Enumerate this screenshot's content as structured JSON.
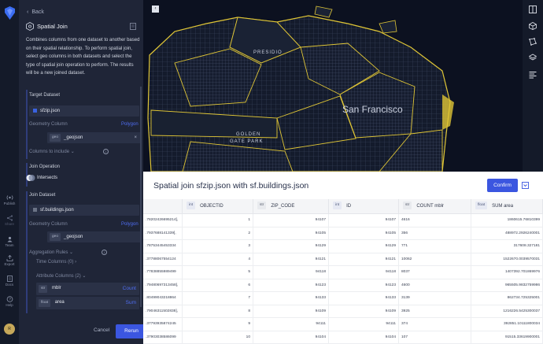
{
  "rail": {
    "items": [
      {
        "label": "Publish",
        "icon": "broadcast-icon"
      },
      {
        "label": "Share",
        "icon": "share-icon"
      },
      {
        "label": "Team",
        "icon": "team-icon"
      },
      {
        "label": "Export",
        "icon": "export-icon"
      },
      {
        "label": "Docs",
        "icon": "docs-icon"
      },
      {
        "label": "Help",
        "icon": "help-icon"
      }
    ],
    "avatar_initials": "R"
  },
  "panel": {
    "back_label": "Back",
    "title": "Spatial Join",
    "description": "Combines columns from one dataset to another based on their spatial relationship. To perform spatial join, select geo columns in both datasets and select the type of spatial join operation to perform. The results will be a new joined dataset.",
    "target": {
      "section_label": "Target Dataset",
      "dataset": "sfzip.json",
      "geometry_label": "Geometry Column",
      "geometry_type": "Polygon",
      "geometry_chip": "geo",
      "geometry_value": "_geojson",
      "columns_label": "Columns to include"
    },
    "join_operation": {
      "section_label": "Join Operation",
      "value": "Intersects"
    },
    "join": {
      "section_label": "Join Dataset",
      "dataset": "sf.buildings.json",
      "geometry_label": "Geometry Column",
      "geometry_type": "Polygon",
      "geometry_chip": "geo",
      "geometry_value": "_geojson",
      "aggregation_label": "Aggregation Rules",
      "time_columns_label": "Time Columns (0)",
      "attribute_columns_label": "Attribute Columns (2)",
      "rules": [
        {
          "chip": "str",
          "name": "mblr",
          "agg": "Count"
        },
        {
          "chip": "float",
          "name": "area",
          "agg": "Sum"
        }
      ]
    },
    "cancel_label": "Cancel",
    "rerun_label": "Rerun"
  },
  "map": {
    "city_label": "San Francisco",
    "presidio_label": "PRESIDIO",
    "park_label_1": "GOLDEN",
    "park_label_2": "GATE PARK",
    "collapse_glyph": "‹"
  },
  "table": {
    "title": "Spatial join sfzip.json with sf.buildings.json",
    "confirm_label": "Confirm",
    "columns": [
      {
        "type": "",
        "name": ""
      },
      {
        "type": "int",
        "name": "OBJECTID"
      },
      {
        "type": "str",
        "name": "ZIP_CODE"
      },
      {
        "type": "int",
        "name": "ID"
      },
      {
        "type": "str",
        "name": "COUNT mblr"
      },
      {
        "type": "float",
        "name": "SUM area"
      }
    ],
    "rows": [
      [
        ".78202426695214],",
        "1",
        "94107",
        "94107",
        "4616",
        "1860615.76810399"
      ],
      [
        ".7937688141339],",
        "2",
        "94105",
        "94105",
        "356",
        "488972.2926240001"
      ],
      [
        ".78753445453334",
        "3",
        "94129",
        "94129",
        "771",
        "317608.327181"
      ],
      [
        ".37788067554124",
        "4",
        "94121",
        "94121",
        "10062",
        "1522670.0039570031"
      ],
      [
        ".77838855989499",
        "5",
        "94118",
        "94118",
        "8037",
        "1407392.701869976"
      ],
      [
        ".79480697313458],",
        "6",
        "94123",
        "94123",
        "4600",
        "965505.9832759986"
      ],
      [
        ".80499043218864",
        "7",
        "94133",
        "94133",
        "3139",
        "862734.725325001"
      ],
      [
        ".79046311502838],",
        "8",
        "94109",
        "94109",
        "3925",
        "1216226.5425300037"
      ],
      [
        ".37793935874245",
        "9",
        "94111",
        "94111",
        "374",
        "392851.10111800034"
      ],
      [
        ".37903038586099",
        "10",
        "94104",
        "94104",
        "107",
        "91515.33619900001"
      ]
    ]
  }
}
